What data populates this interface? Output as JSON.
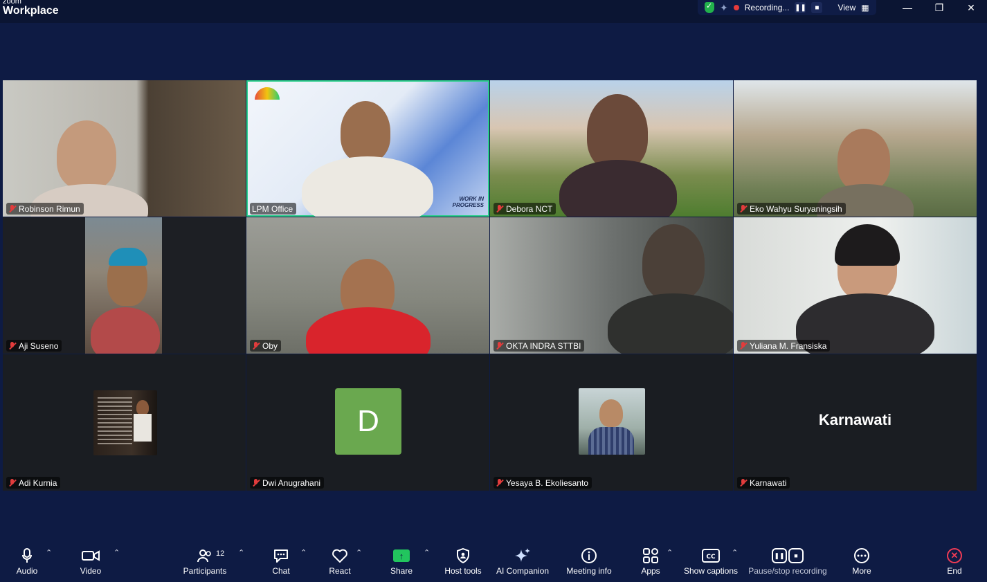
{
  "app": {
    "logo_small": "zoom",
    "logo_big": "Workplace"
  },
  "status": {
    "recording_label": "Recording...",
    "view_label": "View"
  },
  "window": {
    "minimize": "—",
    "restore": "❐",
    "close": "✕"
  },
  "participants_grid": [
    {
      "name": "Robinson Rimun",
      "type": "video"
    },
    {
      "name": "LPM Office",
      "type": "video",
      "active": true,
      "banner": "WORK IN PROGRESS"
    },
    {
      "name": "Debora NCT",
      "type": "video"
    },
    {
      "name": "Eko Wahyu Suryaningsih",
      "type": "video"
    },
    {
      "name": "Aji Suseno",
      "type": "video"
    },
    {
      "name": "Oby",
      "type": "video"
    },
    {
      "name": "OKTA INDRA STTBI",
      "type": "video"
    },
    {
      "name": "Yuliana M. Fransiska",
      "type": "video"
    },
    {
      "name": "Adi Kurnia",
      "type": "photo"
    },
    {
      "name": "Dwi Anugrahani",
      "type": "letter",
      "letter": "D"
    },
    {
      "name": "Yesaya B. Ekoliesanto",
      "type": "photo"
    },
    {
      "name": "Karnawati",
      "type": "text",
      "display_name": "Karnawati"
    }
  ],
  "toolbar": {
    "audio": "Audio",
    "video": "Video",
    "participants": "Participants",
    "participants_count": "12",
    "chat": "Chat",
    "react": "React",
    "share": "Share",
    "host_tools": "Host tools",
    "ai_companion": "AI Companion",
    "meeting_info": "Meeting info",
    "apps": "Apps",
    "show_captions": "Show captions",
    "pause_stop_recording": "Pause/stop recording",
    "more": "More",
    "end": "End"
  },
  "colors": {
    "background": "#0e1b44",
    "active_speaker": "#2ccf8b",
    "muted": "#e23c3c",
    "share": "#22c55e",
    "end": "#ef3b55",
    "letter_avatar": "#6aa84f"
  }
}
